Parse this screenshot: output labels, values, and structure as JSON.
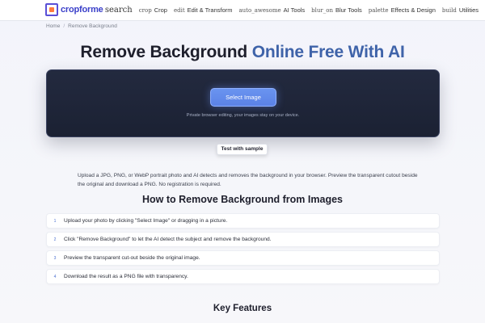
{
  "brand": {
    "name": "cropforme",
    "accent": "#3a3fc9"
  },
  "nav": {
    "search_icon": "search",
    "items": [
      {
        "icon": "crop",
        "label": "Crop"
      },
      {
        "icon": "edit",
        "label": "Edit & Transform"
      },
      {
        "icon": "auto_awesome",
        "label": "AI Tools"
      },
      {
        "icon": "blur_on",
        "label": "Blur Tools"
      },
      {
        "icon": "palette",
        "label": "Effects & Design"
      },
      {
        "icon": "build",
        "label": "Utilities"
      }
    ]
  },
  "breadcrumb": {
    "home": "Home",
    "separator": "/",
    "current": "Remove Background"
  },
  "title": {
    "part1": "Remove Background",
    "part2": "Online Free With AI"
  },
  "upload": {
    "button": "Select Image",
    "privacy": "Private browser editing, your images stay on your device."
  },
  "sample_button": "Test with sample",
  "description": "Upload a JPG, PNG, or WebP portrait photo and AI detects and removes the background in your browser. Preview the transparent cutout beside the original and download a PNG. No registration is required.",
  "how_to": {
    "heading": "How to Remove Background from Images",
    "steps": [
      {
        "num": "1",
        "text": "Upload your photo by clicking \"Select Image\" or dragging in a picture."
      },
      {
        "num": "2",
        "text": "Click \"Remove Background\" to let the AI detect the subject and remove the background."
      },
      {
        "num": "3",
        "text": "Preview the transparent cut-out beside the original image."
      },
      {
        "num": "4",
        "text": "Download the result as a PNG file with transparency."
      }
    ]
  },
  "features_heading": "Key Features"
}
